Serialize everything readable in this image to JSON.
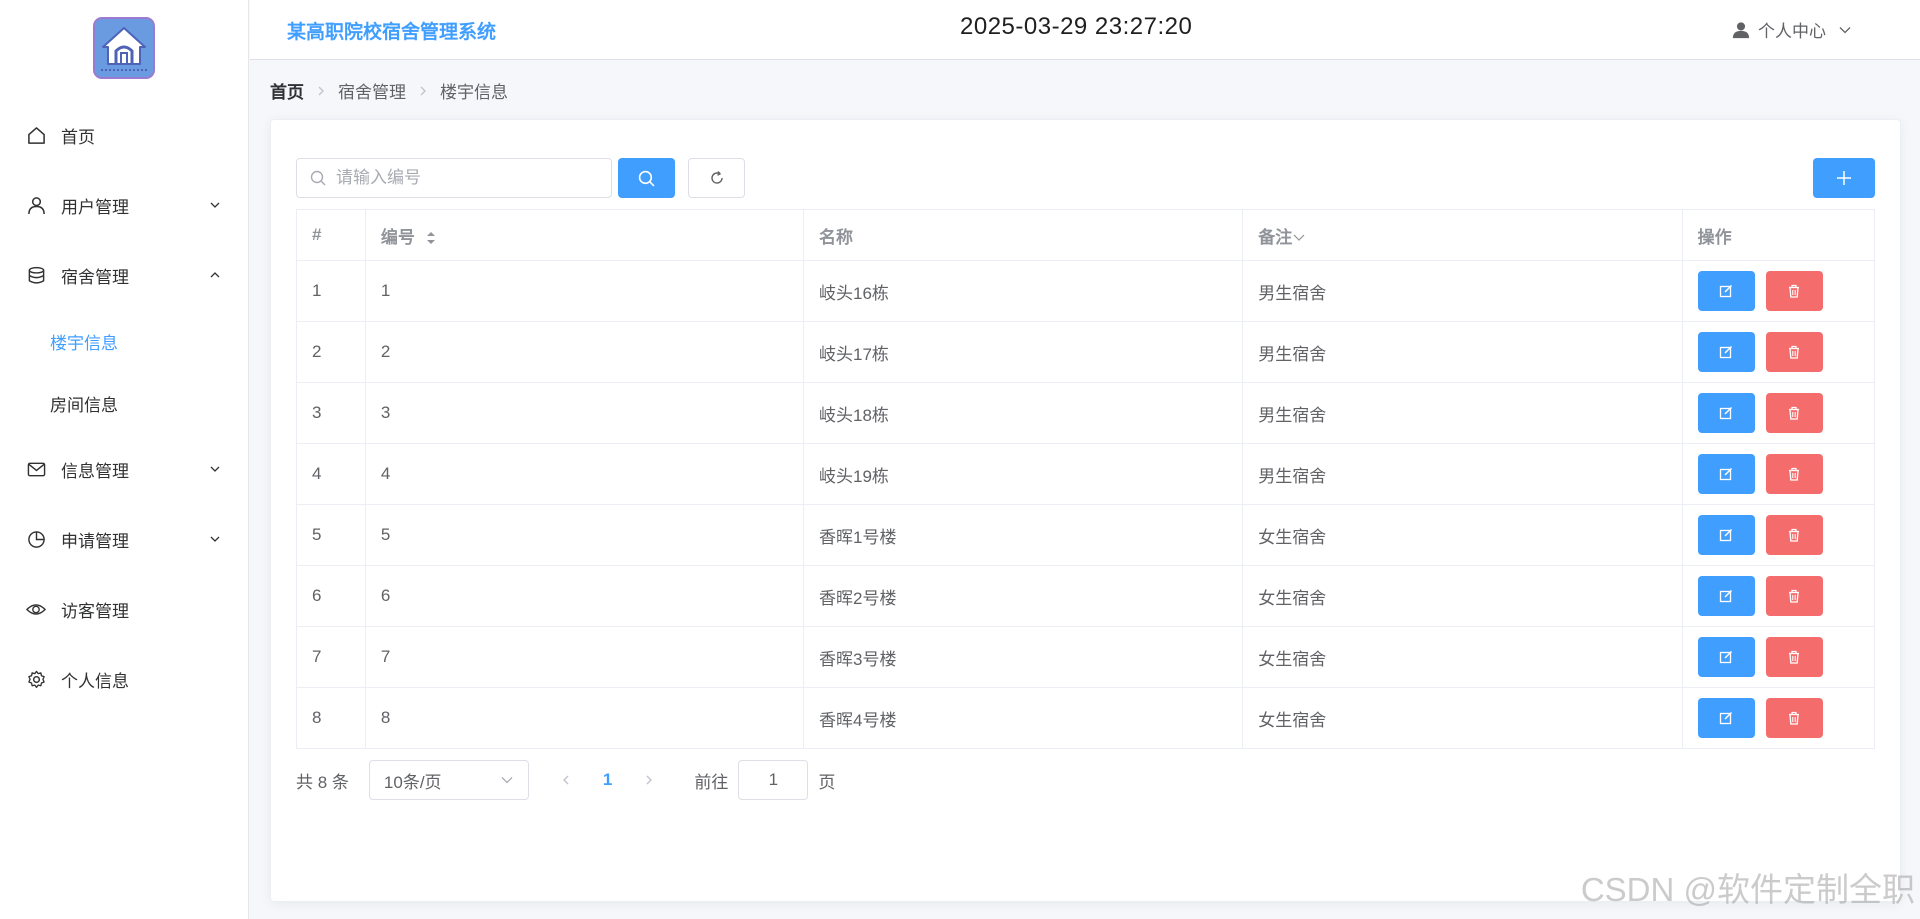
{
  "app": {
    "title": "某高职院校宿舍管理系统",
    "clock": "2025-03-29 23:27:20",
    "user_menu": "个人中心"
  },
  "sidebar": {
    "items": [
      {
        "label": "首页",
        "icon": "home-icon"
      },
      {
        "label": "用户管理",
        "icon": "user-icon",
        "expandable": true,
        "expanded": false
      },
      {
        "label": "宿舍管理",
        "icon": "database-icon",
        "expandable": true,
        "expanded": true,
        "children": [
          {
            "label": "楼宇信息",
            "active": true
          },
          {
            "label": "房间信息",
            "active": false
          }
        ]
      },
      {
        "label": "信息管理",
        "icon": "message-icon",
        "expandable": true,
        "expanded": false
      },
      {
        "label": "申请管理",
        "icon": "pie-chart-icon",
        "expandable": true,
        "expanded": false
      },
      {
        "label": "访客管理",
        "icon": "eye-icon"
      },
      {
        "label": "个人信息",
        "icon": "gear-icon"
      }
    ]
  },
  "breadcrumb": [
    "首页",
    "宿舍管理",
    "楼宇信息"
  ],
  "search": {
    "placeholder": "请输入编号",
    "value": ""
  },
  "table": {
    "columns": [
      "#",
      "编号",
      "名称",
      "备注",
      "操作"
    ],
    "rows": [
      {
        "index": "1",
        "code": "1",
        "name": "岐头16栋",
        "remark": "男生宿舍"
      },
      {
        "index": "2",
        "code": "2",
        "name": "岐头17栋",
        "remark": "男生宿舍"
      },
      {
        "index": "3",
        "code": "3",
        "name": "岐头18栋",
        "remark": "男生宿舍"
      },
      {
        "index": "4",
        "code": "4",
        "name": "岐头19栋",
        "remark": "男生宿舍"
      },
      {
        "index": "5",
        "code": "5",
        "name": "香晖1号楼",
        "remark": "女生宿舍"
      },
      {
        "index": "6",
        "code": "6",
        "name": "香晖2号楼",
        "remark": "女生宿舍"
      },
      {
        "index": "7",
        "code": "7",
        "name": "香晖3号楼",
        "remark": "女生宿舍"
      },
      {
        "index": "8",
        "code": "8",
        "name": "香晖4号楼",
        "remark": "女生宿舍"
      }
    ]
  },
  "pagination": {
    "total": "共 8 条",
    "page_size": "10条/页",
    "current_page": "1",
    "goto_label": "前往",
    "goto_value": "1",
    "goto_suffix": "页"
  },
  "watermark": "CSDN @软件定制全职",
  "colors": {
    "primary": "#409eff",
    "danger": "#f56c6c",
    "text": "#303133",
    "muted": "#909399"
  }
}
